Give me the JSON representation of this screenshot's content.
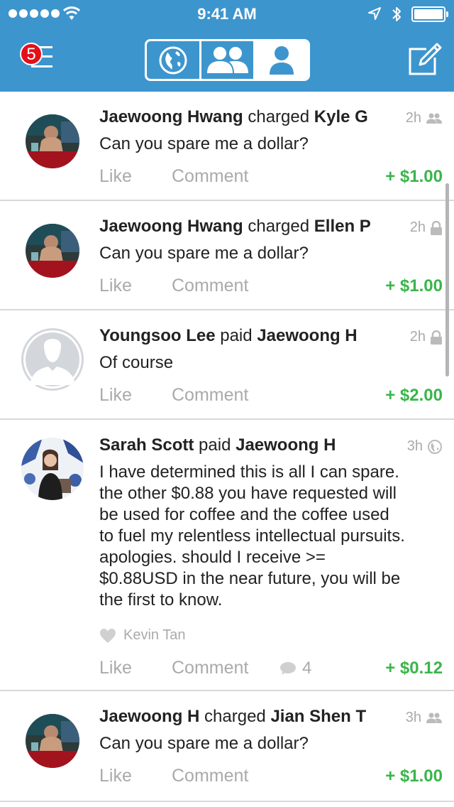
{
  "status_bar": {
    "time": "9:41 AM"
  },
  "nav": {
    "notification_count": "5",
    "tabs": [
      "global",
      "friends",
      "you"
    ],
    "active_tab": "you"
  },
  "feed": [
    {
      "actor": "Jaewoong Hwang",
      "verb": "charged",
      "target": "Kyle G",
      "time": "2h",
      "privacy": "friends",
      "message": "Can you spare me a dollar?",
      "like": "Like",
      "comment": "Comment",
      "amount": "+ $1.00"
    },
    {
      "actor": "Jaewoong Hwang",
      "verb": "charged",
      "target": "Ellen P",
      "time": "2h",
      "privacy": "private",
      "message": "Can you spare me a dollar?",
      "like": "Like",
      "comment": "Comment",
      "amount": "+ $1.00"
    },
    {
      "actor": "Youngsoo Lee",
      "verb": "paid",
      "target": "Jaewoong H",
      "time": "2h",
      "privacy": "private",
      "message": "Of course",
      "like": "Like",
      "comment": "Comment",
      "amount": "+ $2.00"
    },
    {
      "actor": "Sarah Scott",
      "verb": "paid",
      "target": "Jaewoong H",
      "time": "3h",
      "privacy": "public",
      "message_lines": [
        "I have determined this is all I can spare.",
        "the other $0.88 you have requested will",
        "be used for coffee and the coffee used",
        "to fuel my relentless intellectual pursuits.",
        "apologies. should I receive >=",
        "$0.88USD in the near future, you will be",
        "the first to know."
      ],
      "liked_by": "Kevin Tan",
      "comment_count": "4",
      "like": "Like",
      "comment": "Comment",
      "amount": "+ $0.12"
    },
    {
      "actor": "Jaewoong H",
      "verb": "charged",
      "target": "Jian Shen T",
      "time": "3h",
      "privacy": "friends",
      "message": "Can you spare me a dollar?",
      "like": "Like",
      "comment": "Comment",
      "amount": "+ $1.00"
    }
  ],
  "colors": {
    "brand_blue": "#3d95ce",
    "amount_green": "#3ab54a",
    "badge_red": "#e3101a"
  }
}
